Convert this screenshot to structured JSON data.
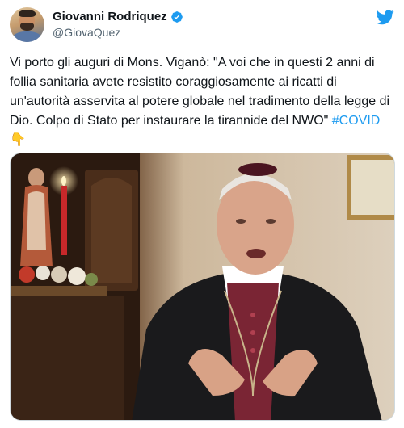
{
  "author": {
    "display_name": "Giovanni Rodriquez",
    "handle": "@GiovaQuez",
    "verified": true,
    "avatar_icon": "user-avatar"
  },
  "tweet": {
    "text_main": "Vi porto gli auguri di Mons. Viganò: \"A voi che in questi 2 anni di follia sanitaria avete resistito coraggiosamente ai ricatti di un'autorità asservita al potere globale nel tradimento della legge di Dio. Colpo di Stato per instaurare la tirannide del NWO\" ",
    "hashtag": "#COVID",
    "emoji": "👇"
  },
  "icons": {
    "logo": "twitter-bird-icon",
    "verified": "verified-badge-icon"
  },
  "colors": {
    "accent": "#1d9bf0",
    "text": "#0f1419",
    "secondary_text": "#536471"
  }
}
